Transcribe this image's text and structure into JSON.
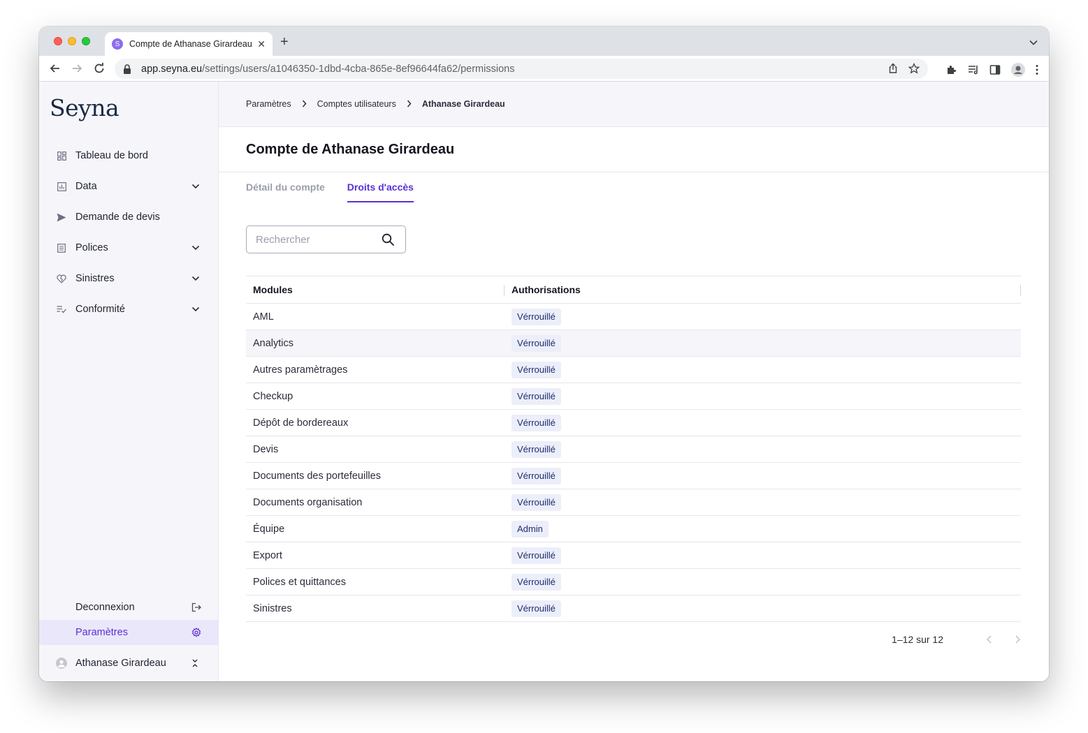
{
  "browser": {
    "tab_favicon": "S",
    "tab_title": "Compte de Athanase Girardeau",
    "url_host": "app.seyna.eu",
    "url_path": "/settings/users/a1046350-1dbd-4cba-865e-8ef96644fa62/permissions"
  },
  "sidebar": {
    "logo": "Seyna",
    "items": [
      {
        "label": "Tableau de bord",
        "icon": "dashboard-icon",
        "expandable": false
      },
      {
        "label": "Data",
        "icon": "chart-icon",
        "expandable": true
      },
      {
        "label": "Demande de devis",
        "icon": "send-icon",
        "expandable": false
      },
      {
        "label": "Polices",
        "icon": "document-list-icon",
        "expandable": true
      },
      {
        "label": "Sinistres",
        "icon": "heart-broken-icon",
        "expandable": true
      },
      {
        "label": "Conformité",
        "icon": "checklist-icon",
        "expandable": true
      }
    ],
    "logout_label": "Deconnexion",
    "settings_label": "Paramètres",
    "user_name": "Athanase Girardeau"
  },
  "breadcrumb": [
    "Paramètres",
    "Comptes utilisateurs",
    "Athanase Girardeau"
  ],
  "page": {
    "title": "Compte de Athanase Girardeau",
    "tabs": [
      "Détail du compte",
      "Droits d'accès"
    ],
    "active_tab": 1,
    "search_placeholder": "Rechercher"
  },
  "table": {
    "headers": {
      "modules": "Modules",
      "authorisations": "Authorisations"
    },
    "rows": [
      {
        "module": "AML",
        "permission": "Vérrouillé"
      },
      {
        "module": "Analytics",
        "permission": "Vérrouillé"
      },
      {
        "module": "Autres paramètrages",
        "permission": "Vérrouillé"
      },
      {
        "module": "Checkup",
        "permission": "Vérrouillé"
      },
      {
        "module": "Dépôt de bordereaux",
        "permission": "Vérrouillé"
      },
      {
        "module": "Devis",
        "permission": "Vérrouillé"
      },
      {
        "module": "Documents des portefeuilles",
        "permission": "Vérrouillé"
      },
      {
        "module": "Documents organisation",
        "permission": "Vérrouillé"
      },
      {
        "module": "Équipe",
        "permission": "Admin"
      },
      {
        "module": "Export",
        "permission": "Vérrouillé"
      },
      {
        "module": "Polices et quittances",
        "permission": "Vérrouillé"
      },
      {
        "module": "Sinistres",
        "permission": "Vérrouillé"
      }
    ],
    "pagination": "1–12 sur 12"
  },
  "colors": {
    "accent": "#5b2fd6",
    "badge_bg": "#eceef9",
    "badge_text": "#1e2c6e",
    "sidebar_bg": "#f6f6fa"
  }
}
